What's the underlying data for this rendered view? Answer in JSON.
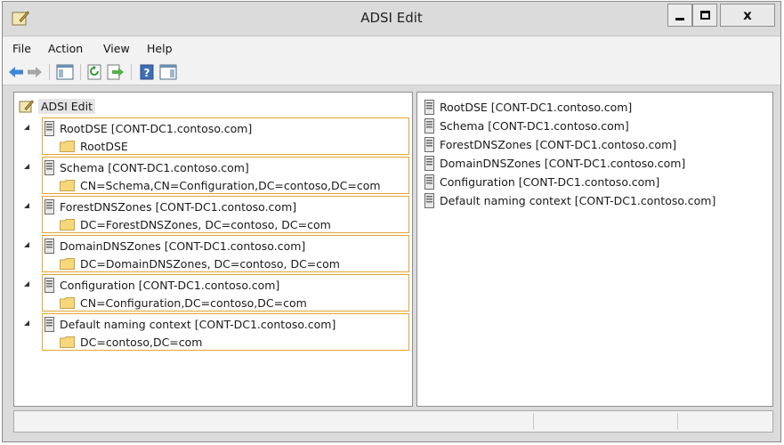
{
  "window": {
    "title": "ADSI Edit"
  },
  "menubar": {
    "items": [
      "File",
      "Action",
      "View",
      "Help"
    ]
  },
  "toolbar": {
    "buttons": [
      "back-arrow-icon",
      "forward-arrow-icon",
      "show-hide-console-tree-icon",
      "refresh-icon",
      "export-list-icon",
      "help-icon",
      "show-action-pane-icon"
    ]
  },
  "tree": {
    "root_label": "ADSI Edit",
    "nodes": [
      {
        "label": "RootDSE [CONT-DC1.contoso.com]",
        "child": "RootDSE"
      },
      {
        "label": "Schema [CONT-DC1.contoso.com]",
        "child": "CN=Schema,CN=Configuration,DC=contoso,DC=com"
      },
      {
        "label": "ForestDNSZones [CONT-DC1.contoso.com]",
        "child": "DC=ForestDNSZones, DC=contoso, DC=com"
      },
      {
        "label": "DomainDNSZones [CONT-DC1.contoso.com]",
        "child": "DC=DomainDNSZones, DC=contoso, DC=com"
      },
      {
        "label": "Configuration [CONT-DC1.contoso.com]",
        "child": "CN=Configuration,DC=contoso,DC=com"
      },
      {
        "label": "Default naming context [CONT-DC1.contoso.com]",
        "child": "DC=contoso,DC=com"
      }
    ]
  },
  "details": {
    "items": [
      "RootDSE [CONT-DC1.contoso.com]",
      "Schema [CONT-DC1.contoso.com]",
      "ForestDNSZones [CONT-DC1.contoso.com]",
      "DomainDNSZones [CONT-DC1.contoso.com]",
      "Configuration [CONT-DC1.contoso.com]",
      "Default naming context [CONT-DC1.contoso.com]"
    ]
  },
  "colors": {
    "selection_border": "#e2a531",
    "window_chrome": "#dbdbdb",
    "folder_fill": "#f6d77a"
  }
}
